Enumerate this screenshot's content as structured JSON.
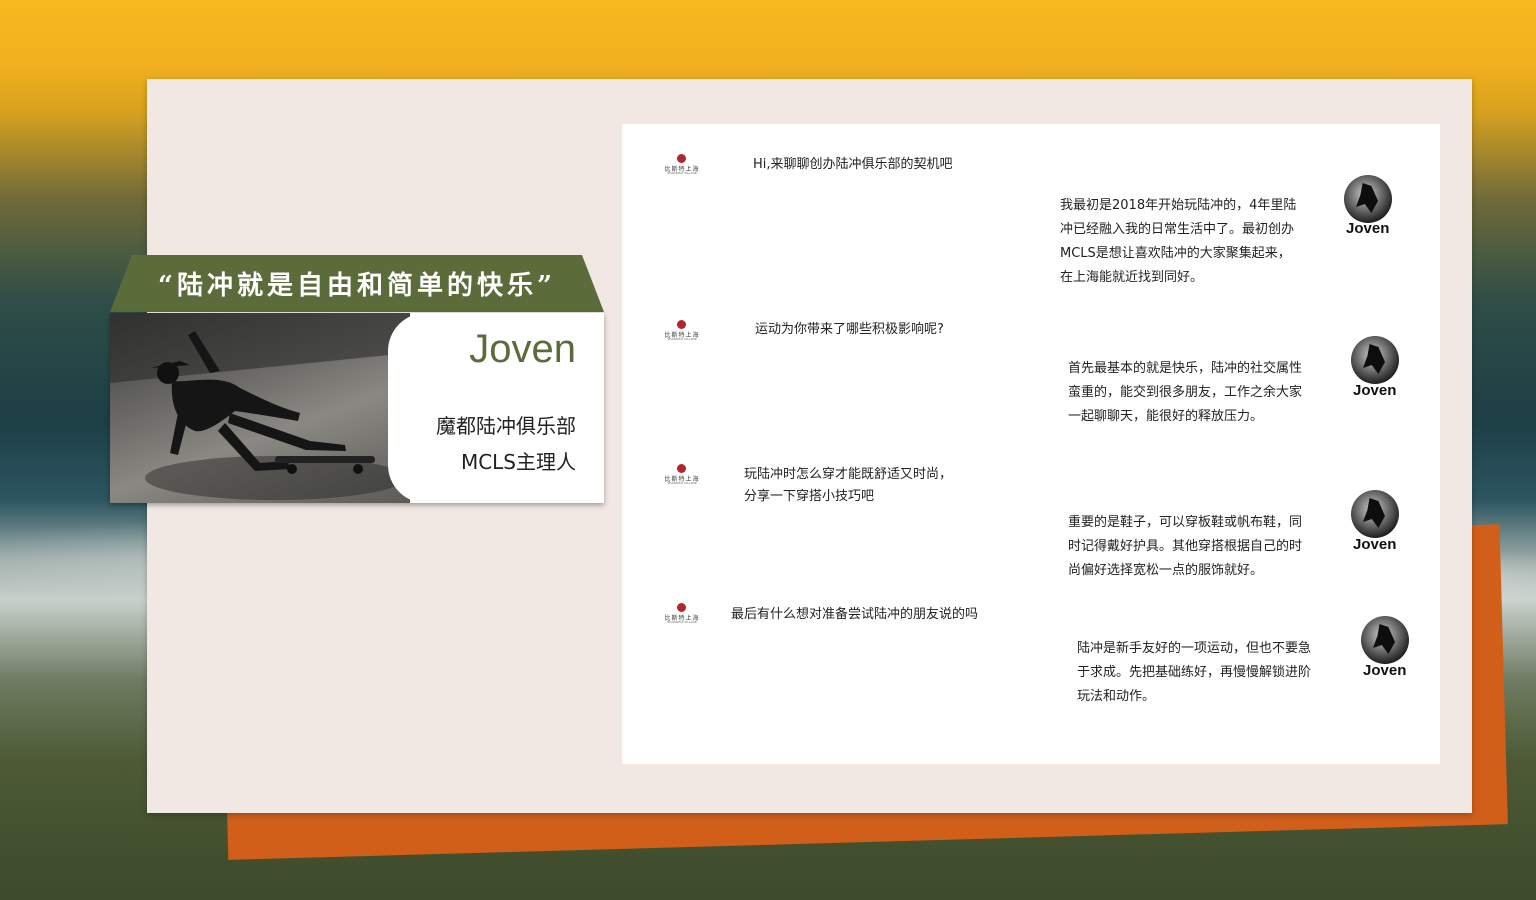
{
  "quote": "“陆冲就是自由和简单的快乐”",
  "profile": {
    "name": "Joven",
    "club": "魔都陆冲俱乐部",
    "title": "MCLS主理人"
  },
  "logo": {
    "cn": "比斯特上海",
    "en": "SHANGHAI VILLAGE"
  },
  "chat": {
    "avatar_label": "Joven",
    "items": [
      {
        "question": [
          "Hi,来聊聊创办陆冲俱乐部的契机吧"
        ],
        "answer": [
          "我最初是2018年开始玩陆冲的，4年里陆",
          "冲已经融入我的日常生活中了。最初创办",
          "MCLS是想让喜欢陆冲的大家聚集起来，",
          "在上海能就近找到同好。"
        ]
      },
      {
        "question": [
          "运动为你带来了哪些积极影响呢?"
        ],
        "answer": [
          "首先最基本的就是快乐，陆冲的社交属性",
          "蛮重的，能交到很多朋友，工作之余大家",
          "一起聊聊天，能很好的释放压力。"
        ]
      },
      {
        "question": [
          "玩陆冲时怎么穿才能既舒适又时尚，",
          "分享一下穿搭小技巧吧"
        ],
        "answer": [
          "重要的是鞋子，可以穿板鞋或帆布鞋，同",
          "时记得戴好护具。其他穿搭根据自己的时",
          "尚偏好选择宽松一点的服饰就好。"
        ]
      },
      {
        "question": [
          "最后有什么想对准备尝试陆冲的朋友说的吗"
        ],
        "answer": [
          "陆冲是新手友好的一项运动，但也不要急",
          "于求成。先把基础练好，再慢慢解锁进阶",
          "玩法和动作。"
        ]
      }
    ]
  }
}
